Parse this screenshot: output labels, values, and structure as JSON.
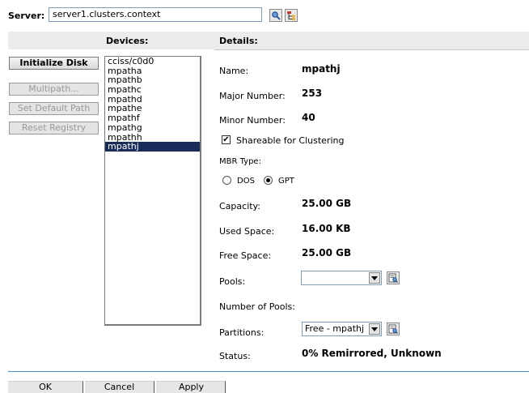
{
  "server": {
    "label": "Server:",
    "value": "server1.clusters.context",
    "browse_icon": "search-icon",
    "tree_icon": "object-tree-icon"
  },
  "headers": {
    "devices": "Devices:",
    "details": "Details:"
  },
  "actions": [
    {
      "label": "Initialize Disk",
      "enabled": true
    },
    {
      "label": "Multipath...",
      "enabled": false
    },
    {
      "label": "Set Default Path",
      "enabled": false
    },
    {
      "label": "Reset Registry",
      "enabled": false
    }
  ],
  "devices": [
    "cciss/c0d0",
    "mpatha",
    "mpathb",
    "mpathc",
    "mpathd",
    "mpathe",
    "mpathf",
    "mpathg",
    "mpathh",
    "mpathj"
  ],
  "selected_device": "mpathj",
  "details": {
    "name_label": "Name:",
    "name_value": "mpathj",
    "major_label": "Major Number:",
    "major_value": "253",
    "minor_label": "Minor Number:",
    "minor_value": "40",
    "shareable_label": "Shareable for Clustering",
    "shareable_checked": true,
    "mbr_label": "MBR Type:",
    "mbr_options": [
      {
        "label": "DOS",
        "selected": false
      },
      {
        "label": "GPT",
        "selected": true
      }
    ],
    "capacity_label": "Capacity:",
    "capacity_value": "25.00 GB",
    "used_label": "Used Space:",
    "used_value": "16.00 KB",
    "free_label": "Free Space:",
    "free_value": "25.00 GB",
    "pools_label": "Pools:",
    "pools_value": "",
    "num_pools_label": "Number of Pools:",
    "partitions_label": "Partitions:",
    "partitions_value": "Free - mpathj",
    "status_label": "Status:",
    "status_value": "0% Remirrored, Unknown"
  },
  "footer": {
    "ok": "OK",
    "cancel": "Cancel",
    "apply": "Apply"
  },
  "colors": {
    "selection": "#1a2c5a",
    "footer_rule": "#4a90c8",
    "header_strip": "#ececec"
  }
}
